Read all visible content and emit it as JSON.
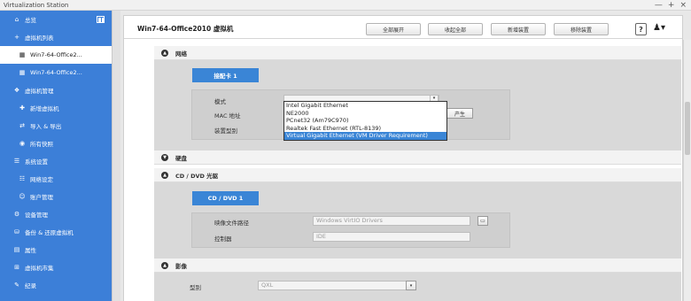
{
  "window": {
    "title": "Virtualization Station",
    "controls": [
      "—",
      "+",
      "×"
    ]
  },
  "sidebar": {
    "items": [
      {
        "label": "总览",
        "icon": "home-icon",
        "glyph": "⌂",
        "level": 0
      },
      {
        "label": "虚拟机列表",
        "icon": "plus-icon",
        "glyph": "+",
        "level": 0
      },
      {
        "label": "Win7-64-Office2...",
        "icon": "windows-icon",
        "glyph": "▦",
        "level": 1,
        "selected": true
      },
      {
        "label": "Win7-64-Office2...",
        "icon": "windows-icon",
        "glyph": "▦",
        "level": 1
      },
      {
        "label": "虚拟机管理",
        "icon": "vm-manage-icon",
        "glyph": "❖",
        "level": 0
      },
      {
        "label": "新增虚拟机",
        "icon": "add-vm-icon",
        "glyph": "✚",
        "level": 1
      },
      {
        "label": "导入 & 导出",
        "icon": "import-export-icon",
        "glyph": "⇄",
        "level": 1
      },
      {
        "label": "所有快照",
        "icon": "snapshot-icon",
        "glyph": "◉",
        "level": 1
      },
      {
        "label": "系统设置",
        "icon": "settings-icon",
        "glyph": "☰",
        "level": 0
      },
      {
        "label": "网络设定",
        "icon": "network-icon",
        "glyph": "☷",
        "level": 1
      },
      {
        "label": "账户管理",
        "icon": "account-icon",
        "glyph": "☺",
        "level": 1
      },
      {
        "label": "设备管理",
        "icon": "device-icon",
        "glyph": "⚙",
        "level": 0
      },
      {
        "label": "备份 & 还原虚拟机",
        "icon": "backup-icon",
        "glyph": "⛁",
        "level": 0
      },
      {
        "label": "属性",
        "icon": "properties-icon",
        "glyph": "▤",
        "level": 0
      },
      {
        "label": "虚拟机市集",
        "icon": "market-icon",
        "glyph": "⊞",
        "level": 0
      },
      {
        "label": "纪录",
        "icon": "log-icon",
        "glyph": "✎",
        "level": 0
      }
    ]
  },
  "toolbar": {
    "vm_title": "Win7-64-Office2010 虚拟机",
    "expand_all": "全部展开",
    "collapse_all": "收起全部",
    "add_device": "新增装置",
    "remove_device": "移除装置",
    "help": "?",
    "user": "♟▾"
  },
  "network": {
    "header": "网络",
    "tab": "接配卡 1",
    "mode_label": "模式",
    "mac_label": "MAC 地址",
    "device_type_label": "装置型别",
    "generate_btn": "产生",
    "options": [
      "Intel Gigabit Ethernet",
      "NE2000",
      "PCnet32 (Am79C970)",
      "Realtek Fast Ethernet (RTL-8139)",
      "Virtual Gigabit Ethernet (VM Driver Requirement)"
    ],
    "selected_index": 4
  },
  "disk": {
    "header": "硬盘"
  },
  "cdrom": {
    "header": "CD / DVD 光驱",
    "tab": "CD / DVD 1",
    "image_path_label": "映像文件路径",
    "image_path_value": "Windows VirtIO Drivers",
    "controller_label": "控制器",
    "controller_value": "IDE"
  },
  "video": {
    "header": "影像",
    "type_label": "型别",
    "type_value": "QXL"
  }
}
